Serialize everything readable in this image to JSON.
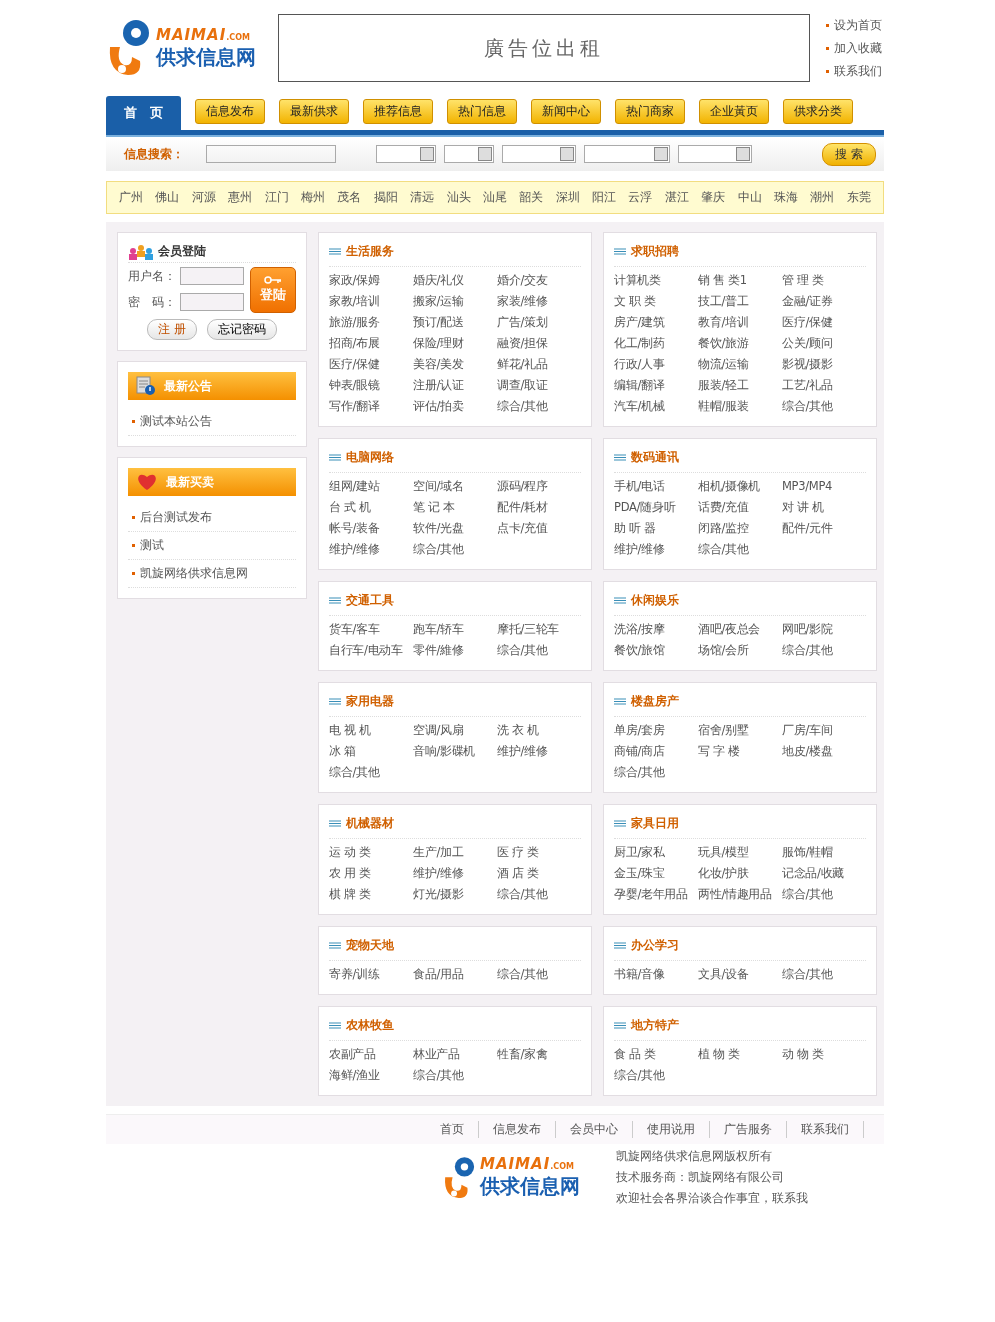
{
  "header": {
    "logo": {
      "brand": "MAIMAI",
      "domain": ".COM",
      "name": "供求信息网"
    },
    "ad_banner": "廣告位出租",
    "top_links": [
      "设为首页",
      "加入收藏",
      "联系我们"
    ]
  },
  "nav": [
    {
      "label": "首　页",
      "selected": true
    },
    {
      "label": "信息发布",
      "selected": false
    },
    {
      "label": "最新供求",
      "selected": false
    },
    {
      "label": "推荐信息",
      "selected": false
    },
    {
      "label": "热门信息",
      "selected": false
    },
    {
      "label": "新闻中心",
      "selected": false
    },
    {
      "label": "热门商家",
      "selected": false
    },
    {
      "label": "企业黃页",
      "selected": false
    },
    {
      "label": "供求分类",
      "selected": false
    }
  ],
  "search": {
    "label": "信息搜索：",
    "button": "搜 索"
  },
  "cities": [
    "广州",
    "佛山",
    "河源",
    "惠州",
    "江门",
    "梅州",
    "茂名",
    "揭阳",
    "清远",
    "汕头",
    "汕尾",
    "韶关",
    "深圳",
    "阳江",
    "云浮",
    "湛江",
    "肇庆",
    "中山",
    "珠海",
    "潮州",
    "东莞"
  ],
  "login": {
    "title": "会员登陆",
    "username_label": "用户名：",
    "password_label": "密　码：",
    "login_button": "登陆",
    "register_button": "注 册",
    "forgot_button": "忘记密码"
  },
  "notices": {
    "title": "最新公告",
    "items": [
      "测试本站公告"
    ]
  },
  "trades": {
    "title": "最新买卖",
    "items": [
      "后台测试发布",
      "测试",
      "凯旋网络供求信息网"
    ]
  },
  "categories": [
    {
      "title": "生活服务",
      "items": [
        "家政/保姆",
        "婚庆/礼仪",
        "婚介/交友",
        "家教/培训",
        "搬家/运输",
        "家装/维修",
        "旅游/服务",
        "预订/配送",
        "广告/策划",
        "招商/布展",
        "保险/理财",
        "融资/担保",
        "医疗/保健",
        "美容/美发",
        "鲜花/礼品",
        "钟表/眼镜",
        "注册/认证",
        "调查/取证",
        "写作/翻译",
        "评估/拍卖",
        "综合/其他"
      ]
    },
    {
      "title": "求职招聘",
      "items": [
        "计算机类",
        "销 售 类1",
        "管 理 类",
        "文 职 类",
        "技工/普工",
        "金融/证券",
        "房产/建筑",
        "教育/培训",
        "医疗/保健",
        "化工/制药",
        "餐饮/旅游",
        "公关/顾问",
        "行政/人事",
        "物流/运输",
        "影视/摄影",
        "编辑/翻译",
        "服装/轻工",
        "工艺/礼品",
        "汽车/机械",
        "鞋帽/服装",
        "综合/其他"
      ]
    },
    {
      "title": "电脑网络",
      "items": [
        "组网/建站",
        "空间/域名",
        "源码/程序",
        "台 式 机",
        "笔 记 本",
        "配件/耗材",
        "帐号/装备",
        "软件/光盘",
        "点卡/充值",
        "维护/维修",
        "综合/其他"
      ]
    },
    {
      "title": "数码通讯",
      "items": [
        "手机/电话",
        "相机/摄像机",
        "MP3/MP4",
        "PDA/随身听",
        "话费/充值",
        "对 讲 机",
        "助 听 器",
        "闭路/监控",
        "配件/元件",
        "维护/维修",
        "综合/其他"
      ]
    },
    {
      "title": "交通工具",
      "items": [
        "货车/客车",
        "跑车/轿车",
        "摩托/三轮车",
        "自行车/电动车",
        "零件/維修",
        "综合/其他"
      ]
    },
    {
      "title": "休闲娱乐",
      "items": [
        "洗浴/按摩",
        "酒吧/夜总会",
        "网吧/影院",
        "餐饮/旅馆",
        "场馆/会所",
        "综合/其他"
      ]
    },
    {
      "title": "家用电器",
      "items": [
        "电 视 机",
        "空调/风扇",
        "洗 衣 机",
        "冰 箱",
        "音响/影碟机",
        "维护/维修",
        "综合/其他"
      ]
    },
    {
      "title": "楼盘房产",
      "items": [
        "单房/套房",
        "宿舍/别墅",
        "厂房/车间",
        "商铺/商店",
        "写 字 楼",
        "地皮/楼盘",
        "综合/其他"
      ]
    },
    {
      "title": "机械器材",
      "items": [
        "运 动 类",
        "生产/加工",
        "医 疗 类",
        "农 用 类",
        "维护/维修",
        "酒 店 类",
        "棋 牌 类",
        "灯光/摄影",
        "综合/其他"
      ]
    },
    {
      "title": "家具日用",
      "items": [
        "厨卫/家私",
        "玩具/模型",
        "服饰/鞋帽",
        "金玉/珠宝",
        "化妆/护肤",
        "记念品/收藏",
        "孕婴/老年用品",
        "两性/情趣用品",
        "综合/其他"
      ]
    },
    {
      "title": "宠物天地",
      "items": [
        "寄养/训练",
        "食品/用品",
        "综合/其他"
      ]
    },
    {
      "title": "办公学习",
      "items": [
        "书籍/音像",
        "文具/设备",
        "综合/其他"
      ]
    },
    {
      "title": "农林牧鱼",
      "items": [
        "农副产品",
        "林业产品",
        "牲畜/家禽",
        "海鲜/渔业",
        "综合/其他"
      ]
    },
    {
      "title": "地方特产",
      "items": [
        "食 品 类",
        "植 物 类",
        "动 物 类",
        "综合/其他"
      ]
    }
  ],
  "footer": {
    "links": [
      "首页",
      "信息发布",
      "会员中心",
      "使用说用",
      "广告服务",
      "联系我们"
    ],
    "logo": {
      "brand": "MAIMAI",
      "domain": ".COM",
      "name": "供求信息网"
    },
    "lines": [
      "凯旋网络供求信息网版权所有",
      "技术服务商：凯旋网络有限公司",
      "欢迎社会各界洽谈合作事宜，联系我"
    ]
  }
}
